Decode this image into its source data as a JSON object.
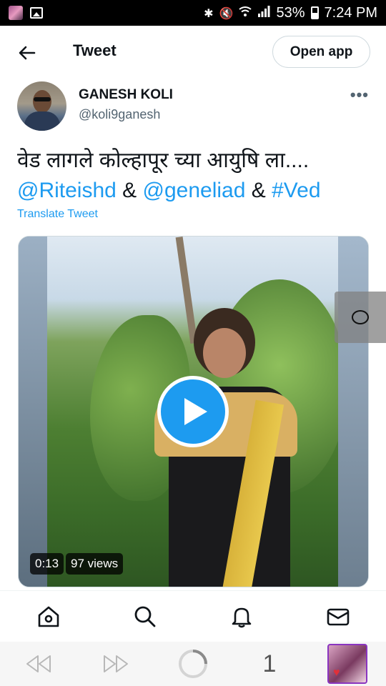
{
  "status_bar": {
    "battery_percent": "53%",
    "time": "7:24 PM",
    "icons": [
      "app-thumbnail-icon",
      "gallery-icon",
      "bluetooth-icon",
      "mute-icon",
      "wifi-icon",
      "signal-icon",
      "battery-icon"
    ]
  },
  "header": {
    "title": "Tweet",
    "open_app_label": "Open app",
    "back_icon": "arrow-left-icon"
  },
  "author": {
    "name": "GANESH KOLI",
    "handle": "@koli9ganesh",
    "more_label": "•••"
  },
  "tweet": {
    "text_line1": "वेड लागले कोल्हापूर च्या आयुषि ला....",
    "mention1": "@Riteishd",
    "amp1": " & ",
    "mention2": "@geneliad",
    "amp2": " & ",
    "hashtag": "#Ved",
    "translate_label": "Translate Tweet"
  },
  "media": {
    "duration": "0:13",
    "views": "97 views"
  },
  "bottom_nav": {
    "items": [
      "home-icon",
      "search-icon",
      "notifications-icon",
      "messages-icon"
    ]
  },
  "browser_bar": {
    "tab_count": "1"
  },
  "colors": {
    "accent": "#1d9bf0",
    "text": "#0f1419",
    "secondary": "#536471"
  }
}
